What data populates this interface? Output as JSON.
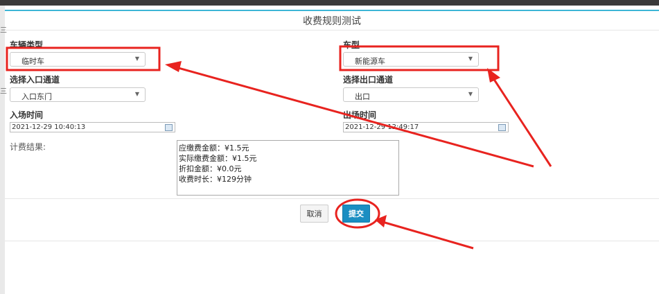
{
  "dialog": {
    "title": "收费规则测试"
  },
  "form": {
    "vehicle_type": {
      "label": "车辆类型",
      "value": "临时车"
    },
    "car_model": {
      "label": "车型",
      "value": "新能源车"
    },
    "entry_channel": {
      "label": "选择入口通道",
      "value": "入口东门"
    },
    "exit_channel": {
      "label": "选择出口通道",
      "value": "出口"
    },
    "entry_time": {
      "label": "入场时间",
      "value": "2021-12-29 10:40:13"
    },
    "exit_time": {
      "label": "出场时间",
      "value": "2021-12-29 12:49:17"
    },
    "result": {
      "label": "计费结果:",
      "lines": [
        "应缴费金额：¥1.5元",
        "实际缴费金额：¥1.5元",
        "折扣金额：¥0.0元",
        "收费时长：¥129分钟"
      ]
    }
  },
  "actions": {
    "cancel_label": "取消",
    "submit_label": "提交"
  },
  "annotation_colors": {
    "highlight": "#e8231f",
    "accent_bar": "#3cb6d6",
    "submit_bg": "#1a8ec2"
  }
}
